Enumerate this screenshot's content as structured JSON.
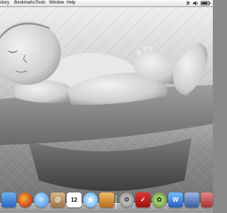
{
  "menubar": {
    "items": [
      "story",
      "Bookmarks",
      "Tools",
      "Window",
      "Help"
    ]
  },
  "wallpaper": {
    "subject": "baby-photo"
  },
  "dock": {
    "icons": [
      {
        "name": "finder-icon",
        "color": "#3b7bd6"
      },
      {
        "name": "firefox-icon",
        "color": "#e8681a"
      },
      {
        "name": "itunes-icon",
        "color": "#3f8fe0"
      },
      {
        "name": "address-book-icon",
        "color": "#b58a55"
      },
      {
        "name": "ical-icon",
        "color": "#ffffff",
        "label": "12"
      },
      {
        "name": "xcode-icon",
        "color": "#4aa3e8"
      },
      {
        "name": "iphoto-icon",
        "color": "#d98a2a"
      },
      {
        "name": "system-preferences-icon",
        "color": "#9a9a9a"
      },
      {
        "name": "activity-monitor-icon",
        "color": "#444444"
      },
      {
        "name": "acrobat-icon",
        "color": "#c9201c"
      },
      {
        "name": "camino-icon",
        "color": "#6a9a2a"
      },
      {
        "name": "dashboard-icon",
        "color": "#3a3a3a"
      },
      {
        "name": "word-icon",
        "color": "#2a5ab8"
      },
      {
        "name": "preview-icon",
        "color": "#5a7ab8"
      },
      {
        "name": "stacks-icon",
        "color": "#c05050"
      }
    ]
  }
}
